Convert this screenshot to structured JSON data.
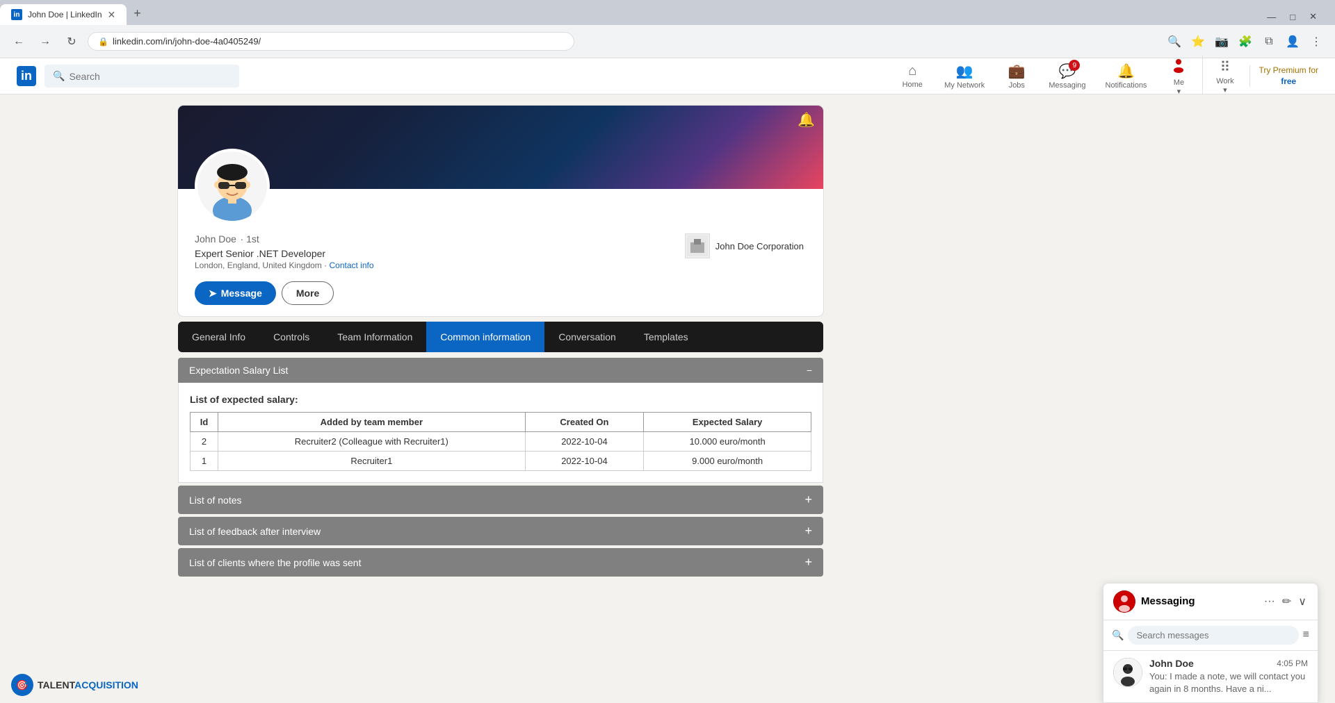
{
  "browser": {
    "tab_title": "John Doe | LinkedIn",
    "tab_icon": "in",
    "url": "linkedin.com/in/john-doe-4a0405249/",
    "new_tab_symbol": "+",
    "nav": {
      "back": "←",
      "forward": "→",
      "reload": "↻"
    },
    "window_controls": {
      "minimize": "—",
      "maximize": "□",
      "close": "✕"
    }
  },
  "navbar": {
    "logo": "in",
    "search_placeholder": "Search",
    "nav_items": [
      {
        "id": "home",
        "icon": "⌂",
        "label": "Home",
        "badge": null
      },
      {
        "id": "network",
        "icon": "👥",
        "label": "My Network",
        "badge": null
      },
      {
        "id": "jobs",
        "icon": "💼",
        "label": "Jobs",
        "badge": null
      },
      {
        "id": "messaging",
        "icon": "💬",
        "label": "Messaging",
        "badge": "9"
      },
      {
        "id": "notifications",
        "icon": "🔔",
        "label": "Notifications",
        "badge": null
      },
      {
        "id": "me",
        "icon": "👤",
        "label": "Me",
        "badge": null,
        "has_dropdown": true
      },
      {
        "id": "work",
        "icon": "⠿",
        "label": "Work",
        "badge": null,
        "has_dropdown": true
      }
    ],
    "premium": {
      "line1": "Try Premium for",
      "line2": "free"
    }
  },
  "profile": {
    "name": "John Doe",
    "connection": "1st",
    "headline": "Expert Senior .NET Developer",
    "location": "London, England, United Kingdom",
    "contact_info_label": "Contact info",
    "company_name": "John Doe Corporation",
    "bell_icon": "🔔",
    "message_btn": "Message",
    "more_btn": "More"
  },
  "plugin_tabs": [
    {
      "id": "general-info",
      "label": "General Info",
      "active": false
    },
    {
      "id": "controls",
      "label": "Controls",
      "active": false
    },
    {
      "id": "team-information",
      "label": "Team Information",
      "active": false
    },
    {
      "id": "common-information",
      "label": "Common information",
      "active": true
    },
    {
      "id": "conversation",
      "label": "Conversation",
      "active": false
    },
    {
      "id": "templates",
      "label": "Templates",
      "active": false
    }
  ],
  "salary_section": {
    "header": "Expectation Salary List",
    "collapse_icon": "−",
    "list_title": "List of expected salary:",
    "table_headers": [
      "Id",
      "Added by team member",
      "Created On",
      "Expected Salary"
    ],
    "rows": [
      {
        "id": "2",
        "added_by": "Recruiter2 (Colleague with Recruiter1)",
        "created_on": "2022-10-04",
        "expected_salary": "10.000 euro/month"
      },
      {
        "id": "1",
        "added_by": "Recruiter1",
        "created_on": "2022-10-04",
        "expected_salary": "9.000 euro/month"
      }
    ]
  },
  "collapsible_sections": [
    {
      "id": "notes",
      "label": "List of notes",
      "icon": "+"
    },
    {
      "id": "feedback",
      "label": "List of feedback after interview",
      "icon": "+"
    },
    {
      "id": "clients",
      "label": "List of clients where the profile was sent",
      "icon": "+"
    }
  ],
  "messaging": {
    "title": "Messaging",
    "more_icon": "···",
    "edit_icon": "✏",
    "chevron_down": "∨",
    "search_placeholder": "Search messages",
    "filter_icon": "≡",
    "conversations": [
      {
        "name": "John Doe",
        "time": "4:05 PM",
        "preview": "You: I made a note, we will contact you again in 8 months. Have a ni..."
      }
    ]
  },
  "branding": {
    "logo_text1": "TALENT",
    "logo_text2": "ACQUISITION",
    "logo_icon": "🎯"
  }
}
